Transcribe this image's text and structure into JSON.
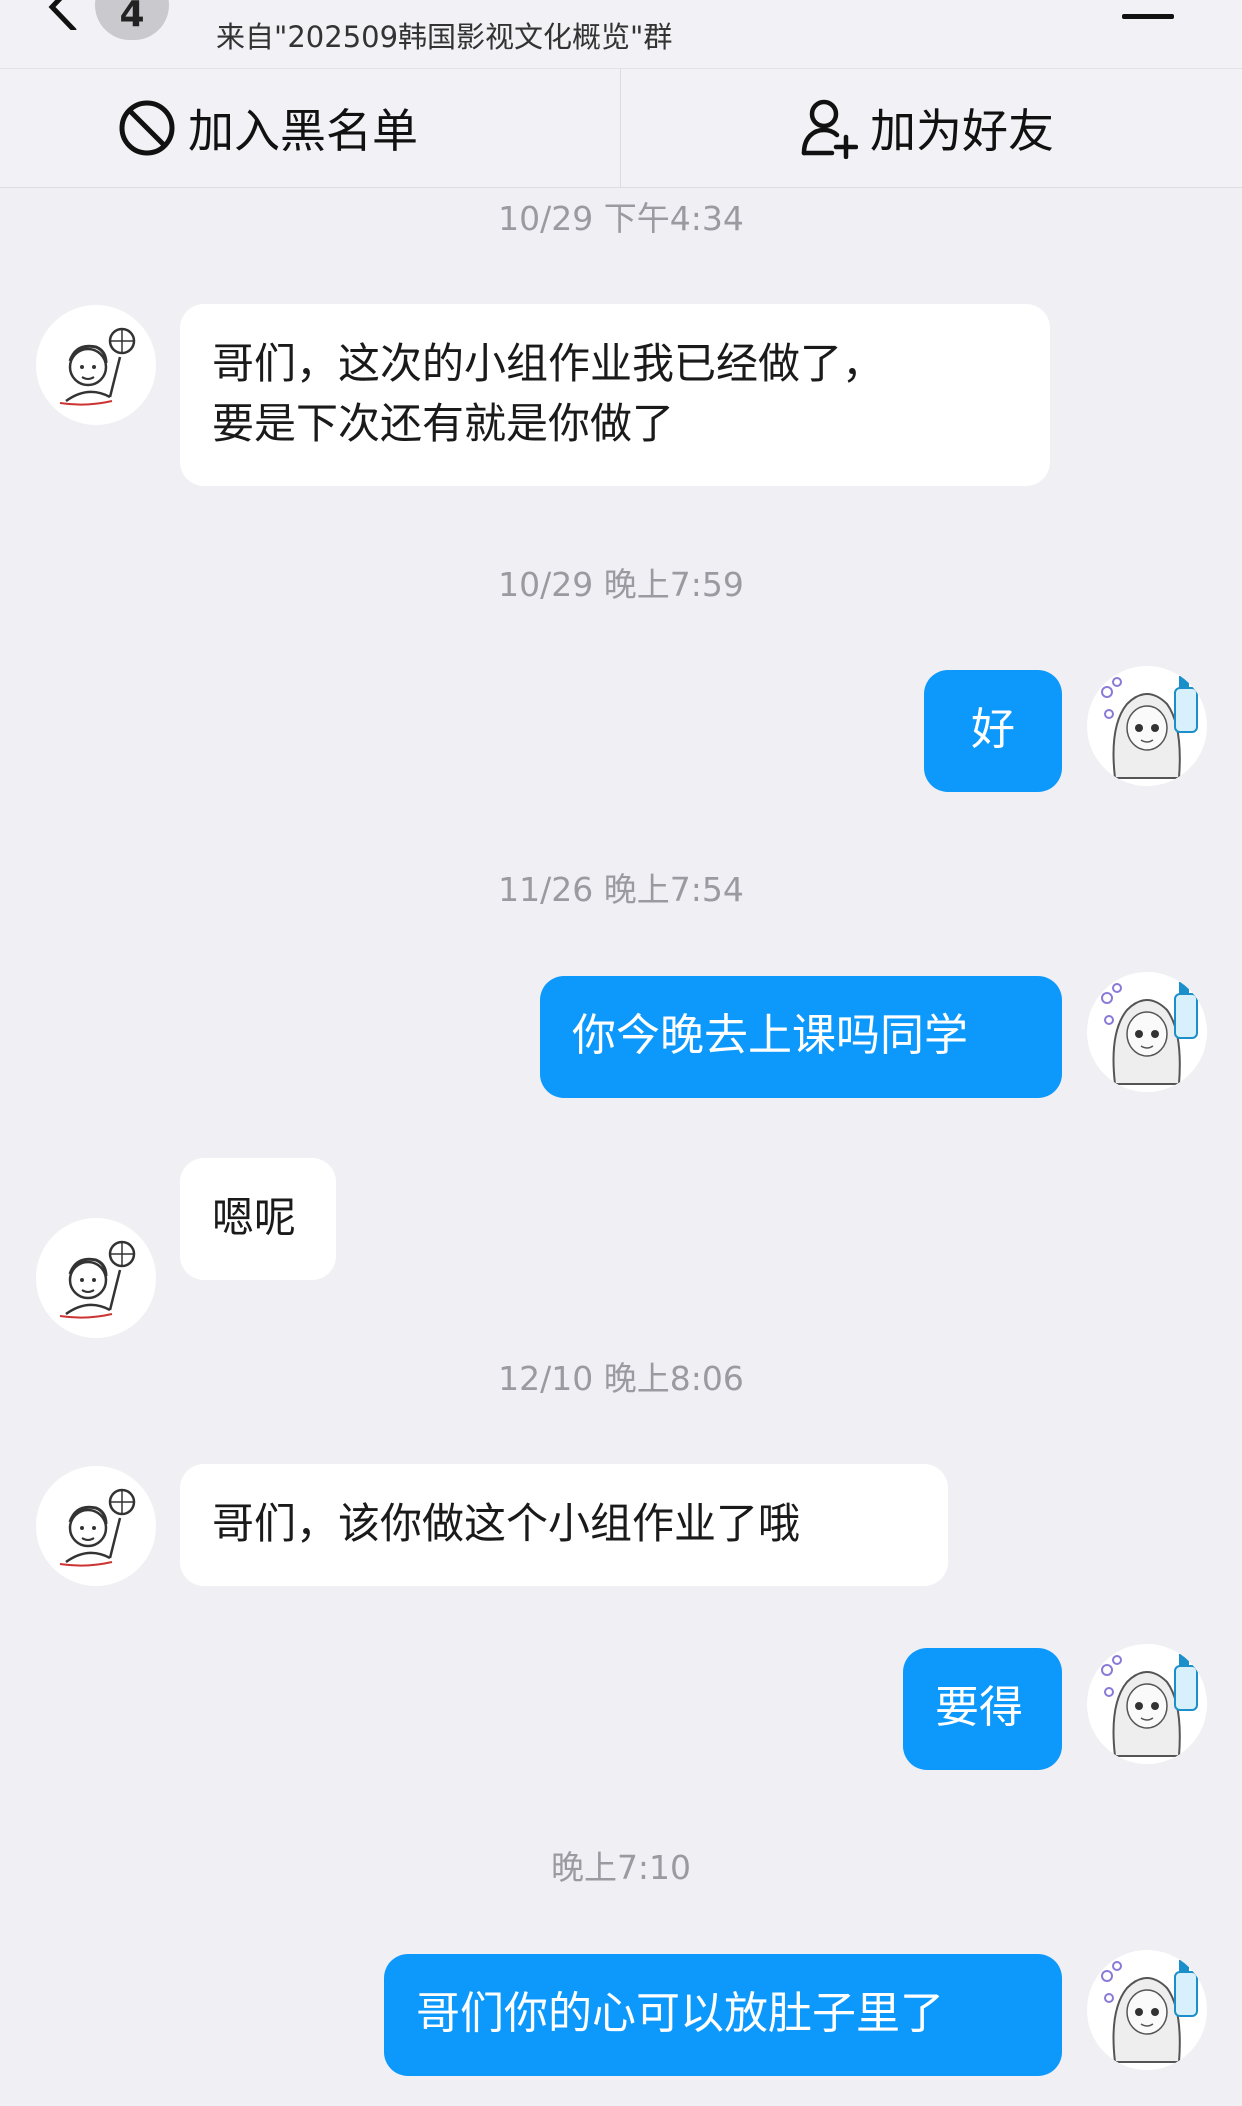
{
  "header": {
    "unread_count": "4",
    "subtitle": "来自\"202509韩国影视文化概览\"群",
    "icons": {
      "back": "chevron-left-icon",
      "menu": "menu-icon"
    }
  },
  "actions": {
    "block_label": "加入黑名单",
    "add_friend_label": "加为好友",
    "icons": {
      "block": "prohibited-icon",
      "add_friend": "add-user-icon"
    }
  },
  "colors": {
    "outgoing_bubble": "#0d99fc",
    "incoming_bubble": "#ffffff",
    "background": "#f0f0f4"
  },
  "messages": [
    {
      "type": "timestamp",
      "text": "10/29 下午4:34"
    },
    {
      "type": "incoming",
      "text_lines": [
        "哥们，这次的小组作业我已经做了，",
        "要是下次还有就是你做了"
      ]
    },
    {
      "type": "timestamp",
      "text": "10/29 晚上7:59"
    },
    {
      "type": "outgoing",
      "text": "好"
    },
    {
      "type": "timestamp",
      "text": "11/26 晚上7:54"
    },
    {
      "type": "outgoing",
      "text": "你今晚去上课吗同学"
    },
    {
      "type": "incoming",
      "text": "嗯呢"
    },
    {
      "type": "timestamp",
      "text": "12/10 晚上8:06"
    },
    {
      "type": "incoming",
      "text": "哥们，该你做这个小组作业了哦"
    },
    {
      "type": "outgoing",
      "text": "要得"
    },
    {
      "type": "timestamp",
      "text": "晚上7:10"
    },
    {
      "type": "outgoing",
      "text": "哥们你的心可以放肚子里了"
    }
  ]
}
